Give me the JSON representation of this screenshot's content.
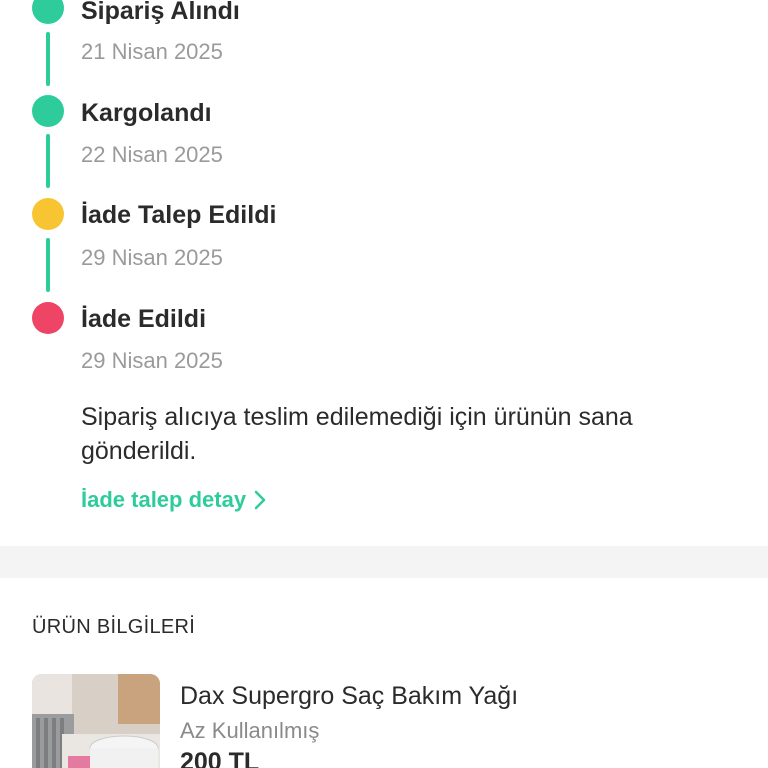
{
  "timeline": {
    "steps": [
      {
        "title": "Sipariş Alındı",
        "date": "21 Nisan 2025",
        "status_color": "#2ecc9b"
      },
      {
        "title": "Kargolandı",
        "date": "22 Nisan 2025",
        "status_color": "#2ecc9b"
      },
      {
        "title": "İade Talep Edildi",
        "date": "29 Nisan 2025",
        "status_color": "#f7c531"
      },
      {
        "title": "İade Edildi",
        "date": "29 Nisan 2025",
        "status_color": "#ee4466"
      }
    ],
    "connector_color": "#2ecc9b",
    "description": "Sipariş alıcıya teslim edilemediği için ürünün sana gönderildi.",
    "detail_link": "İade talep detay",
    "detail_icon": "chevron-right-icon"
  },
  "product_section": {
    "title": "ÜRÜN BİLGİLERİ",
    "product": {
      "name": "Dax Supergro Saç Bakım Yağı",
      "condition": "Az Kullanılmış",
      "price": "200 TL"
    }
  }
}
